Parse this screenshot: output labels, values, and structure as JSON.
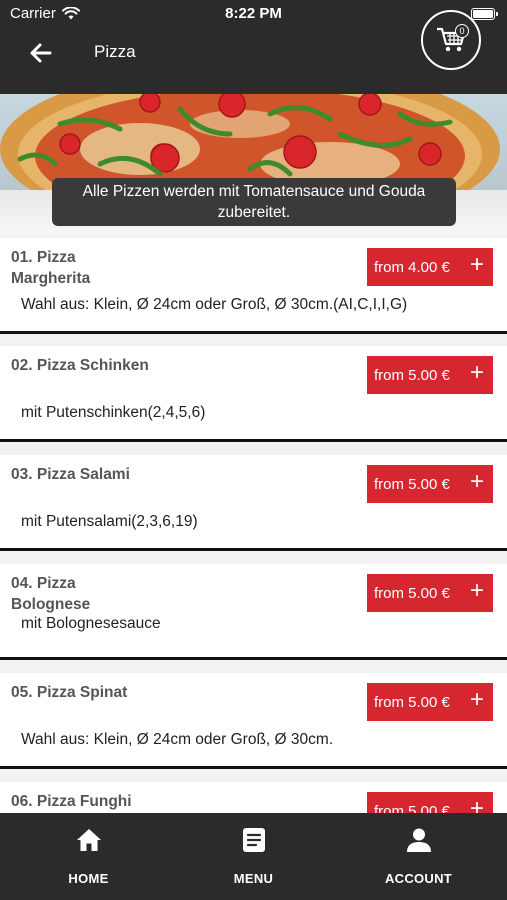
{
  "status_bar": {
    "carrier": "Carrier",
    "time": "8:22 PM"
  },
  "header": {
    "title": "Pizza",
    "cart_count": "0"
  },
  "notice": {
    "line1": "Alle Pizzen werden mit Tomatensauce und Gouda",
    "line2": "zubereitet."
  },
  "items": [
    {
      "name": "01. Pizza Margherita",
      "price_label": "from 4.00 €",
      "description": "Wahl aus: Klein, Ø 24cm oder Groß, Ø 30cm.(AI,C,I,I,G)"
    },
    {
      "name": "02. Pizza Schinken",
      "price_label": "from 5.00 €",
      "description": "mit Putenschinken(2,4,5,6)"
    },
    {
      "name": "03. Pizza Salami",
      "price_label": "from 5.00 €",
      "description": "mit Putensalami(2,3,6,19)"
    },
    {
      "name": "04. Pizza Bolognese",
      "price_label": "from 5.00 €",
      "description": "mit Bolognesesauce"
    },
    {
      "name": "05. Pizza Spinat",
      "price_label": "from 5.00 €",
      "description": "Wahl aus: Klein, Ø 24cm oder Groß, Ø 30cm."
    },
    {
      "name": "06. Pizza Funghi",
      "price_label": "from 5.00 €",
      "description": ""
    }
  ],
  "tabs": [
    {
      "label": "HOME",
      "icon": "home-icon"
    },
    {
      "label": "MENU",
      "icon": "menu-icon"
    },
    {
      "label": "ACCOUNT",
      "icon": "account-icon"
    }
  ],
  "colors": {
    "bar": "#2b2b2b",
    "accent": "#d6262f",
    "card_border": "#111111"
  }
}
